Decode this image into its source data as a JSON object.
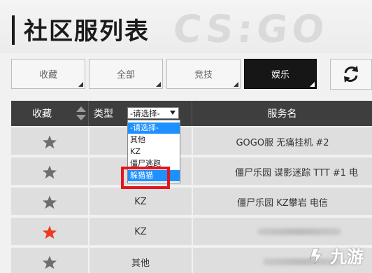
{
  "header": {
    "title": "社区服列表",
    "bg_logo": "CS:GO"
  },
  "filters": [
    {
      "label": "收藏",
      "active": false
    },
    {
      "label": "全部",
      "active": false
    },
    {
      "label": "竞技",
      "active": false
    },
    {
      "label": "娱乐",
      "active": true
    }
  ],
  "refresh_icon": "refresh-icon",
  "table": {
    "headers": {
      "favorite": "收藏",
      "type": "类型",
      "server": "服务名"
    },
    "type_select": {
      "selected": "-请选择-",
      "options": [
        "-请选择-",
        "其他",
        "KZ",
        "僵尸逃跑",
        "躲猫猫"
      ],
      "highlighted": "躲猫猫"
    },
    "rows": [
      {
        "favorited": false,
        "type": "",
        "server": "GOGO服 无痛挂机 #2"
      },
      {
        "favorited": false,
        "type": "",
        "server": "僵尸乐园 谍影迷踪 TTT #1 电"
      },
      {
        "favorited": false,
        "type": "KZ",
        "server": "僵尸乐园 KZ攀岩 电信"
      },
      {
        "favorited": true,
        "type": "KZ",
        "server": ""
      },
      {
        "favorited": false,
        "type": "其他",
        "server": ""
      }
    ]
  },
  "colors": {
    "star_off": "#6e6e6e",
    "star_on": "#ee3b24",
    "header_bg": "#3e3e3e",
    "active_btn": "#161616",
    "highlight": "#1e90ff",
    "annotation": "#e2151e"
  },
  "watermark": {
    "text": "九游"
  }
}
